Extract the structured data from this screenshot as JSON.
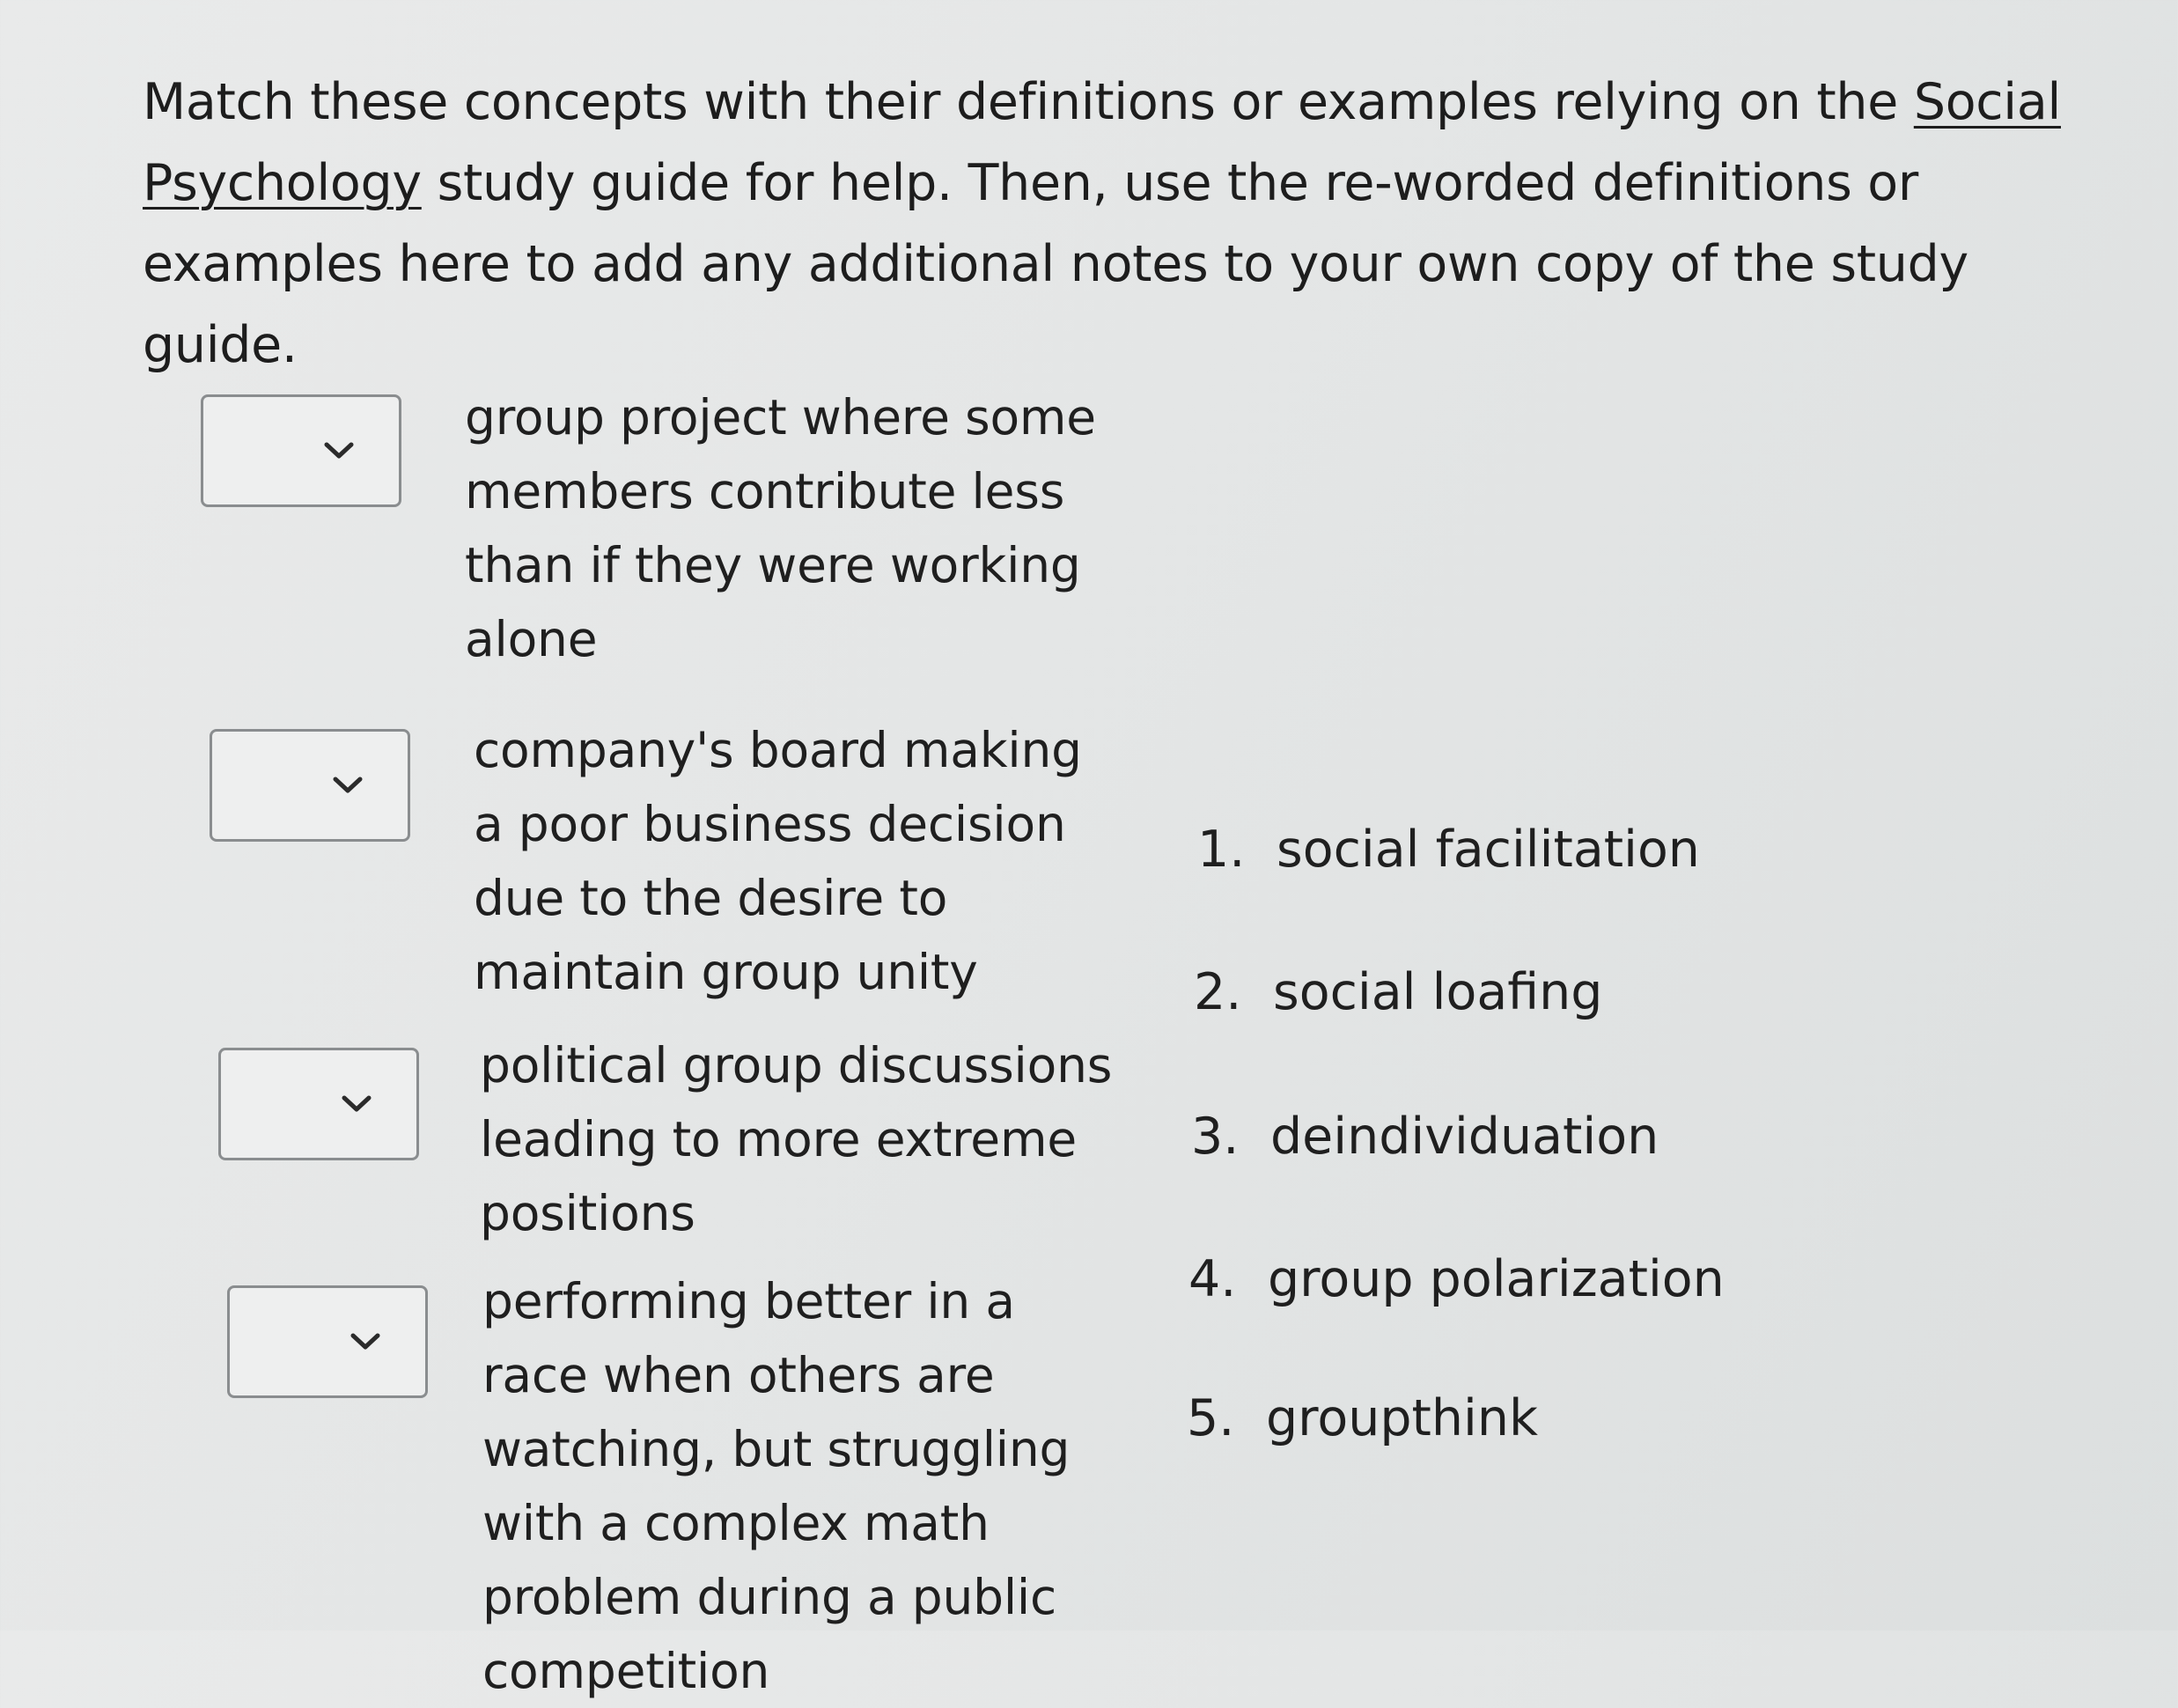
{
  "instructions": {
    "before_link": "Match these concepts with their definitions or examples relying on the ",
    "link": "Social Psychology",
    "after_link": " study guide for help. Then, use the re-worded definitions or examples here to add any additional notes to your own copy of the study guide."
  },
  "prompts": [
    {
      "text": "group project where some members contribute less than if they were working alone",
      "selected": ""
    },
    {
      "text": "company's board making a poor business decision due to the desire to maintain group unity",
      "selected": ""
    },
    {
      "text": "political group discussions leading to more extreme positions",
      "selected": ""
    },
    {
      "text": "performing better in a race when others are watching, but struggling with a complex math problem during a public competition",
      "selected": ""
    }
  ],
  "answers": [
    {
      "number": "1.",
      "label": "social facilitation"
    },
    {
      "number": "2.",
      "label": "social loafing"
    },
    {
      "number": "3.",
      "label": "deindividuation"
    },
    {
      "number": "4.",
      "label": "group polarization"
    },
    {
      "number": "5.",
      "label": "groupthink"
    }
  ],
  "icons": {
    "dropdown_chevron": "chevron-down-icon"
  }
}
